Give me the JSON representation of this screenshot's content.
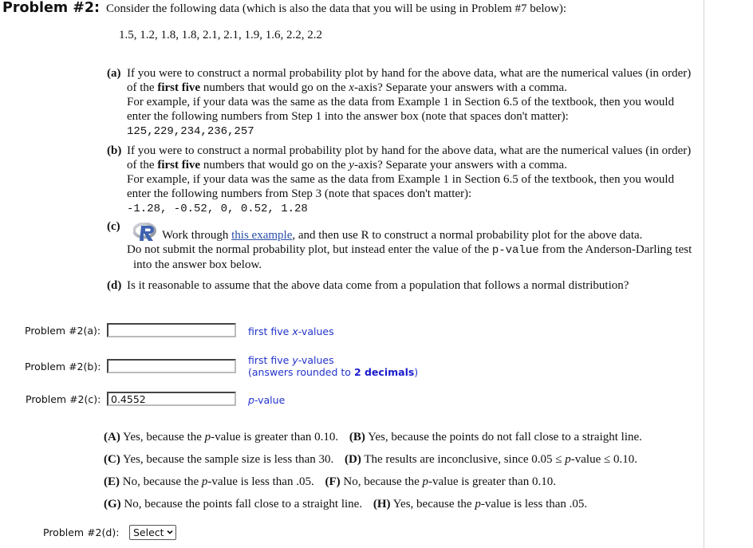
{
  "problem": {
    "title": "Problem #2:",
    "intro": "Consider the following data (which is also the data that you will be using in Problem #7 below):",
    "data_values": "1.5, 1.2, 1.8, 1.8, 2.1, 2.1, 1.9, 1.6, 2.2, 2.2"
  },
  "parts": {
    "a": {
      "label": "(a)",
      "text_1": "If you were to construct a normal probability plot by hand for the above data, what are the numerical values (in order) of the ",
      "bold": "first five",
      "text_2": " numbers that would go on the ",
      "axis": "x",
      "text_3": "-axis? Separate your answers with a comma.",
      "example": "For example, if your data was the same as the data from Example 1 in Section 6.5 of the textbook, then you would enter the following numbers from Step 1 into the answer box (note that spaces don't matter):",
      "example_answer": "125,229,234,236,257"
    },
    "b": {
      "label": "(b)",
      "text_1": "If you were to construct a normal probability plot by hand for the above data, what are the numerical values (in order) of the ",
      "bold": "first five",
      "text_2": " numbers that would go on the ",
      "axis": "y",
      "text_3": "-axis? Separate your answers with a comma.",
      "example": "For example, if your data was the same as the data from Example 1 in Section 6.5 of the textbook, then you would enter the following numbers from Step 3 (note that spaces don't matter):",
      "example_answer": "-1.28, -0.52, 0, 0.52, 1.28"
    },
    "c": {
      "label": "(c)",
      "icon": "r-logo-icon",
      "text_1": "Work through ",
      "link": "this example",
      "text_2": ", and then use R to construct a normal probability plot for the above data.",
      "text_3": "Do not submit the normal probability plot, but instead enter the value of the ",
      "code": "p-value",
      "text_4": " from the Anderson-Darling test into the answer box below."
    },
    "d": {
      "label": "(d)",
      "text": "Is it reasonable to assume that the above data come from a population that follows a normal distribution?"
    }
  },
  "answers": {
    "a": {
      "label": "Problem #2(a):",
      "value": "",
      "hint_1": "first five ",
      "hint_var": "x",
      "hint_2": "-values"
    },
    "b": {
      "label": "Problem #2(b):",
      "value": "",
      "hint_1": "first five ",
      "hint_var": "y",
      "hint_2": "-values",
      "hint_line2_1": "(answers rounded to ",
      "hint_line2_bold": "2 decimals",
      "hint_line2_2": ")"
    },
    "c": {
      "label": "Problem #2(c):",
      "value": "0.4552",
      "hint_var": "p",
      "hint_2": "-value"
    },
    "d": {
      "label": "Problem #2(d):",
      "selected": "Select"
    }
  },
  "choices": [
    {
      "key": "(A)",
      "pre": "Yes, because the ",
      "var": "p",
      "post": "-value is greater than 0.10."
    },
    {
      "key": "(B)",
      "pre": "Yes, because the points do not fall close to a straight line.",
      "var": "",
      "post": ""
    },
    {
      "key": "(C)",
      "pre": "Yes, because the sample size is less than 30.",
      "var": "",
      "post": ""
    },
    {
      "key": "(D)",
      "pre": "The results are inconclusive, since 0.05 ≤ ",
      "var": "p",
      "post": "-value ≤ 0.10."
    },
    {
      "key": "(E)",
      "pre": "No, because the ",
      "var": "p",
      "post": "-value is less than .05."
    },
    {
      "key": "(F)",
      "pre": "No, because the ",
      "var": "p",
      "post": "-value is greater than 0.10."
    },
    {
      "key": "(G)",
      "pre": "No, because the points fall close to a straight line.",
      "var": "",
      "post": ""
    },
    {
      "key": "(H)",
      "pre": "Yes, because the ",
      "var": "p",
      "post": "-value is less than .05."
    }
  ],
  "colors": {
    "hint": "#2233cc",
    "link": "#2a4fa8",
    "divider": "#d4d4d4"
  }
}
